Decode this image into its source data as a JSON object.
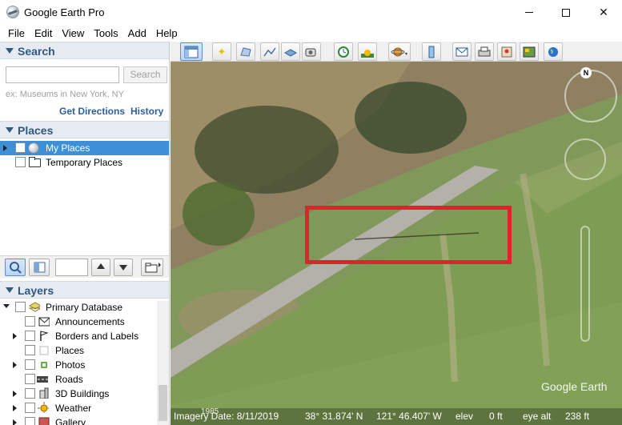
{
  "window": {
    "title": "Google Earth Pro"
  },
  "menu": [
    "File",
    "Edit",
    "View",
    "Tools",
    "Add",
    "Help"
  ],
  "search": {
    "header": "Search",
    "input_value": "",
    "button_label": "Search",
    "hint": "ex: Museums in New York, NY",
    "get_directions": "Get Directions",
    "history": "History"
  },
  "places": {
    "header": "Places",
    "items": [
      {
        "label": "My Places",
        "selected": true
      },
      {
        "label": "Temporary Places",
        "selected": false
      }
    ]
  },
  "layers": {
    "header": "Layers",
    "items": [
      {
        "label": "Primary Database",
        "icon": "layers-icon"
      },
      {
        "label": "Announcements",
        "icon": "envelope-icon"
      },
      {
        "label": "Borders and Labels",
        "icon": "flag-icon"
      },
      {
        "label": "Places",
        "icon": "places-icon"
      },
      {
        "label": "Photos",
        "icon": "photo-icon"
      },
      {
        "label": "Roads",
        "icon": "road-icon"
      },
      {
        "label": "3D Buildings",
        "icon": "building-icon"
      },
      {
        "label": "Weather",
        "icon": "sun-icon"
      },
      {
        "label": "Gallery",
        "icon": "gallery-icon"
      }
    ]
  },
  "map": {
    "watermark": "Google Earth",
    "compass_letter": "N",
    "status": {
      "imagery_year": "1985",
      "imagery_date": "Imagery Date: 8/11/2019",
      "lat": "38° 31.874' N",
      "lon": "121° 46.407' W",
      "elev_label": "elev",
      "elev_value": "0 ft",
      "eye_label": "eye alt",
      "eye_value": "238 ft"
    }
  },
  "colors": {
    "highlight_box": "#e3212b",
    "selection": "#3d8fd6",
    "section_text": "#34577f"
  }
}
